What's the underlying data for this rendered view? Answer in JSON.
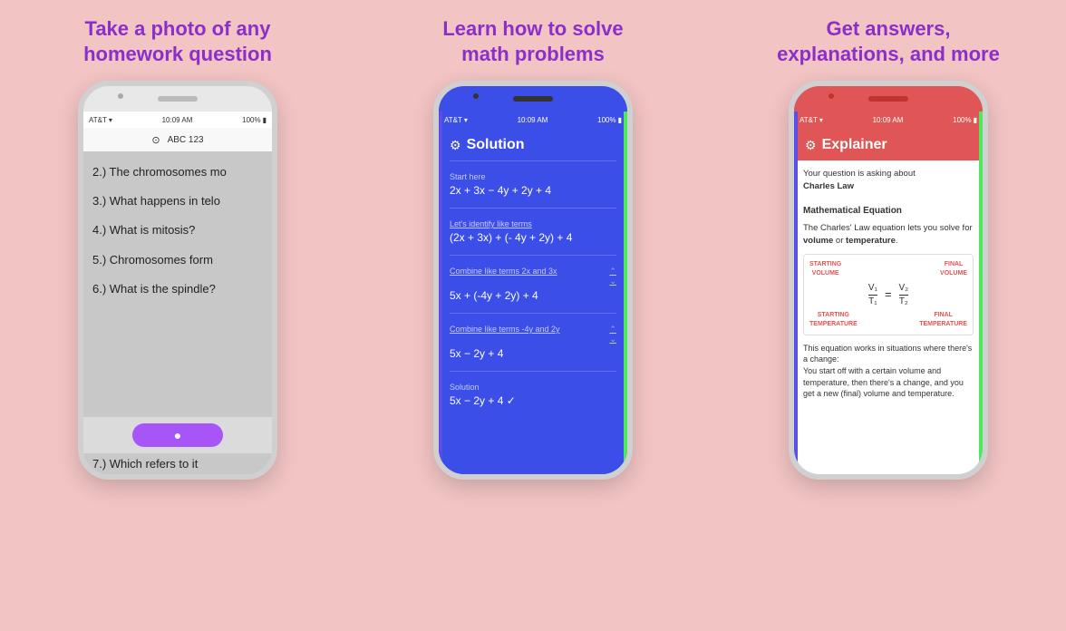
{
  "background": "#f2c4c4",
  "panels": [
    {
      "id": "panel1",
      "title": "Take a photo of any\nhomework question",
      "title_color": "#8b2fc9",
      "phone": {
        "status": {
          "carrier": "AT&T",
          "wifi": true,
          "time": "10:09 AM",
          "battery": "100%"
        },
        "toolbar_icon": "📷",
        "toolbar_text": "ABC  123",
        "questions": [
          "2.) The chromosomes mo",
          "3.) What happens in telo",
          "4.) What is mitosis?",
          "5.) Chromosomes form",
          "6.) What is the spindle?",
          "7.) Which refers to it"
        ],
        "camera_button_icon": "📷"
      }
    },
    {
      "id": "panel2",
      "title": "Learn how to solve\nmath problems",
      "title_color": "#8b2fc9",
      "phone": {
        "status": {
          "carrier": "AT&T",
          "wifi": true,
          "time": "10:09 AM",
          "battery": "100%"
        },
        "header_icon": "⚙",
        "header_title": "Solution",
        "steps": [
          {
            "label": "Start here",
            "label_underline": false,
            "expr": "2x + 3x − 4y + 2y + 4"
          },
          {
            "label": "Let's identify like terms",
            "label_underline": true,
            "expr": "(2x + 3x) + (- 4y + 2y) + 4"
          },
          {
            "label": "Combine like terms 2x and 3x",
            "label_underline": true,
            "expr": "5x + (-4y + 2y) + 4"
          },
          {
            "label": "Combine like terms -4y and 2y",
            "label_underline": true,
            "expr": "5x − 2y + 4"
          },
          {
            "label": "Solution",
            "label_underline": false,
            "expr": "5x − 2y + 4  ✓"
          }
        ]
      }
    },
    {
      "id": "panel3",
      "title": "Get answers,\nexplanations, and more",
      "title_color": "#8b2fc9",
      "phone": {
        "status": {
          "carrier": "AT&T",
          "wifi": true,
          "time": "10:09 AM",
          "battery": "100%"
        },
        "header_icon": "⚙",
        "header_title": "Explainer",
        "intro": "Your question is asking about",
        "topic_bold": "Charles Law",
        "section_title": "Mathematical Equation",
        "section_text1": "The Charles' Law equation lets you solve for ",
        "section_text1_bold1": "volume",
        "section_text1_mid": " or ",
        "section_text1_bold2": "temperature",
        "section_text1_end": ".",
        "diagram": {
          "top_left": "STARTING\nVOLUME",
          "top_right": "FINAL\nVOLUME",
          "v1": "V₁",
          "t1": "T₁",
          "v2": "V₂",
          "t2": "T₂",
          "equals": "=",
          "bot_left": "STARTING\nTEMPERATURE",
          "bot_right": "FINAL\nTEMPERATURE"
        },
        "footer_text": "This equation works in situations where there's a change:\nYou start off with a certain volume and temperature, then there's a change, and you get a new (final) volume and temperature."
      }
    }
  ]
}
